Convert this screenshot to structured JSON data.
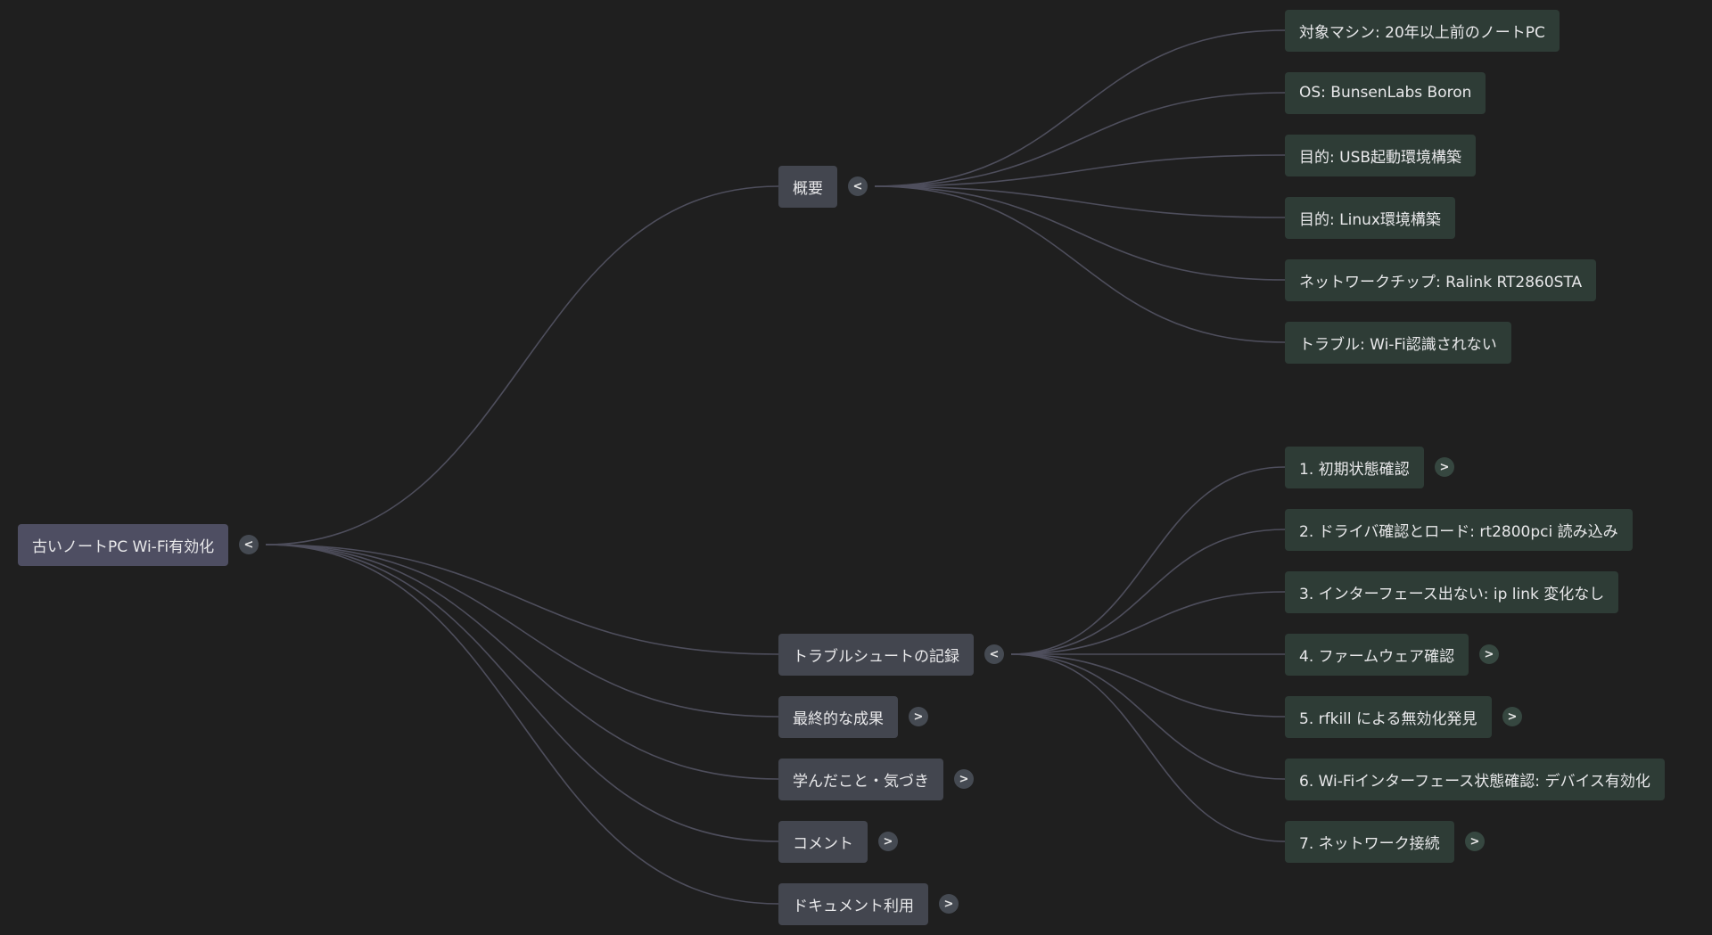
{
  "colors": {
    "background": "#1f1f1f",
    "root_fill": "#4e4e62",
    "branch_fill": "#43464f",
    "leaf_fill": "#2e3c36",
    "link_stroke": "#4e4e5c",
    "toggle_fill": "#454a52",
    "leaf_toggle_fill": "#364740"
  },
  "mindmap": {
    "root": {
      "label": "古いノートPC Wi-Fi有効化",
      "toggle": "<"
    },
    "branches": [
      {
        "key": "overview",
        "label": "概要",
        "toggle": "<",
        "children": [
          {
            "label": "対象マシン: 20年以上前のノートPC",
            "toggle": ""
          },
          {
            "label": "OS: BunsenLabs Boron",
            "toggle": ""
          },
          {
            "label": "目的: USB起動環境構築",
            "toggle": ""
          },
          {
            "label": "目的: Linux環境構築",
            "toggle": ""
          },
          {
            "label": "ネットワークチップ: Ralink RT2860STA",
            "toggle": ""
          },
          {
            "label": "トラブル: Wi-Fi認識されない",
            "toggle": ""
          }
        ]
      },
      {
        "key": "troubleshoot-log",
        "label": "トラブルシュートの記録",
        "toggle": "<",
        "children": [
          {
            "label": "1. 初期状態確認",
            "toggle": ">"
          },
          {
            "label": "2. ドライバ確認とロード: rt2800pci 読み込み",
            "toggle": ""
          },
          {
            "label": "3. インターフェース出ない: ip link 変化なし",
            "toggle": ""
          },
          {
            "label": "4. ファームウェア確認",
            "toggle": ">"
          },
          {
            "label": "5. rfkill による無効化発見",
            "toggle": ">"
          },
          {
            "label": "6. Wi-Fiインターフェース状態確認: デバイス有効化",
            "toggle": ""
          },
          {
            "label": "7. ネットワーク接続",
            "toggle": ">"
          }
        ]
      },
      {
        "key": "final-result",
        "label": "最終的な成果",
        "toggle": ">",
        "children": []
      },
      {
        "key": "learnings",
        "label": "学んだこと・気づき",
        "toggle": ">",
        "children": []
      },
      {
        "key": "comments",
        "label": "コメント",
        "toggle": ">",
        "children": []
      },
      {
        "key": "document-usage",
        "label": "ドキュメント利用",
        "toggle": ">",
        "children": []
      }
    ]
  }
}
